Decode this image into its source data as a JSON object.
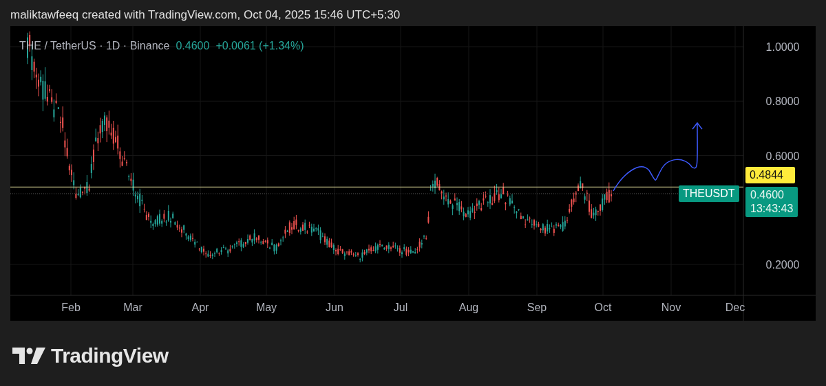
{
  "header": {
    "text": "maliktawfeeq created with TradingView.com, Oct 04, 2025 15:46 UTC+5:30"
  },
  "chart": {
    "symbol": "THE / TetherUS · 1D · Binance",
    "last": "0.4600",
    "change": "+0.0061 (+1.34%)",
    "y_axis_labels": [
      "1.0000",
      "0.8000",
      "0.6000",
      "0.2000"
    ],
    "x_axis_labels": [
      "Feb",
      "Mar",
      "Apr",
      "May",
      "Jun",
      "Jul",
      "Aug",
      "Sep",
      "Oct",
      "Nov",
      "Dec"
    ],
    "line_price": "0.4844",
    "symbol_badge": "THEUSDT",
    "price_badge": "0.4600",
    "countdown": "13:43:43"
  },
  "logo": {
    "text": "TradingView"
  }
}
